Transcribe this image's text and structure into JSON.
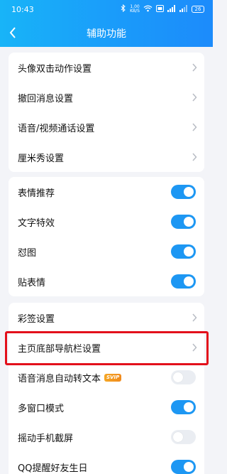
{
  "status": {
    "time": "10:43",
    "network_speed": "1.00\nKB/S",
    "battery": "26"
  },
  "header": {
    "title": "辅助功能"
  },
  "groups": [
    {
      "items": [
        {
          "label": "头像双击动作设置"
        },
        {
          "label": "撤回消息设置"
        },
        {
          "label": "语音/视频通话设置"
        },
        {
          "label": "厘米秀设置"
        }
      ]
    },
    {
      "items": [
        {
          "label": "表情推荐",
          "toggle": "on"
        },
        {
          "label": "文字特效",
          "toggle": "on"
        },
        {
          "label": "怼图",
          "toggle": "on"
        },
        {
          "label": "贴表情",
          "toggle": "on"
        }
      ]
    },
    {
      "items": [
        {
          "label": "彩签设置"
        },
        {
          "label": "主页底部导航栏设置"
        },
        {
          "label": "语音消息自动转文本",
          "badge": "SVIP",
          "toggle": "off"
        },
        {
          "label": "多窗口模式",
          "toggle": "on"
        },
        {
          "label": "摇动手机截屏",
          "toggle": "off"
        },
        {
          "label": "QQ提醒好友生日",
          "toggle": "on"
        }
      ]
    }
  ],
  "colors": {
    "accent": "#1d97f3",
    "highlight": "#e3101b",
    "badge": "#f5a623"
  }
}
